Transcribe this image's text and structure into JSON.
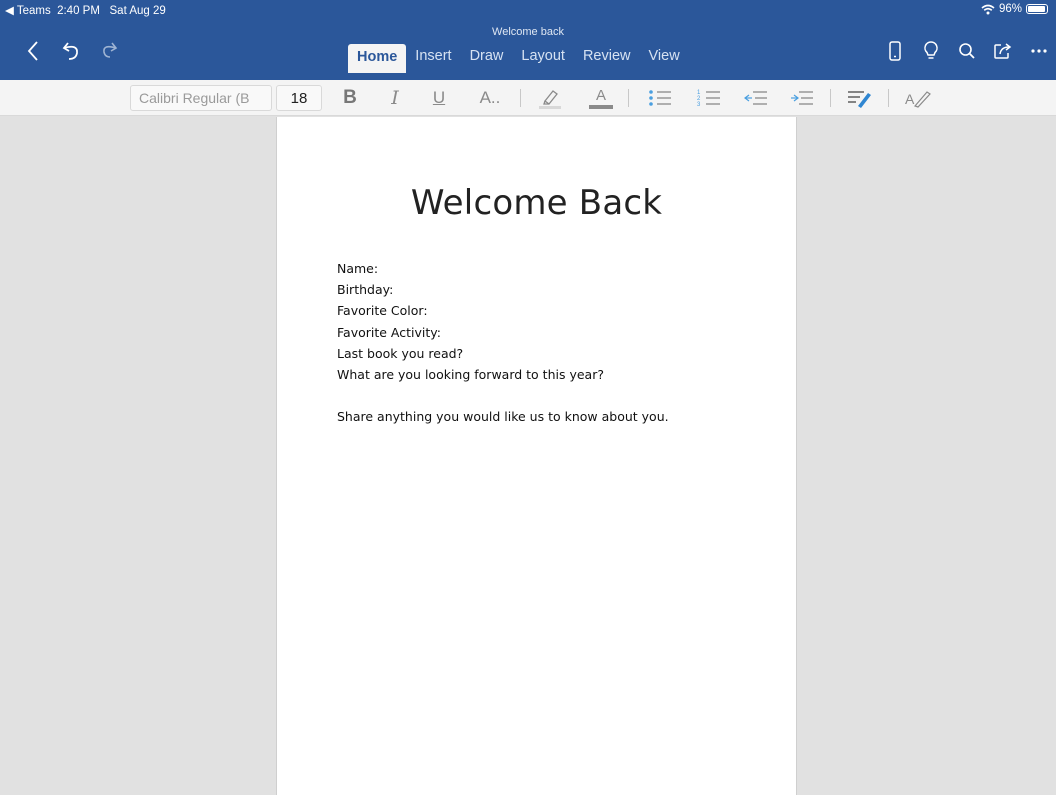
{
  "status_bar": {
    "back_app": "◀ Teams",
    "time": "2:40 PM",
    "date": "Sat Aug 29",
    "battery": "96%"
  },
  "document_title": "Welcome back",
  "tabs": [
    {
      "label": "Home",
      "active": true
    },
    {
      "label": "Insert"
    },
    {
      "label": "Draw"
    },
    {
      "label": "Layout"
    },
    {
      "label": "Review"
    },
    {
      "label": "View"
    }
  ],
  "ribbon": {
    "font_name": "Calibri Regular (B",
    "font_size": "18",
    "bold": "B",
    "italic": "I",
    "underline": "U",
    "font_menu": "A..",
    "font_color": "A"
  },
  "colors": {
    "title_bar": "#2b579a",
    "ribbon_bg": "#f4f4f4",
    "workspace_bg": "#e1e1e1",
    "font_color_swatch": "#8a8a8a"
  },
  "document": {
    "heading": "Welcome Back",
    "lines": [
      "Name:",
      "Birthday:",
      "Favorite Color:",
      "Favorite Activity:",
      "Last book you read?",
      "What are you looking forward to this year?"
    ],
    "closing": "Share anything you would like us to know about you."
  }
}
